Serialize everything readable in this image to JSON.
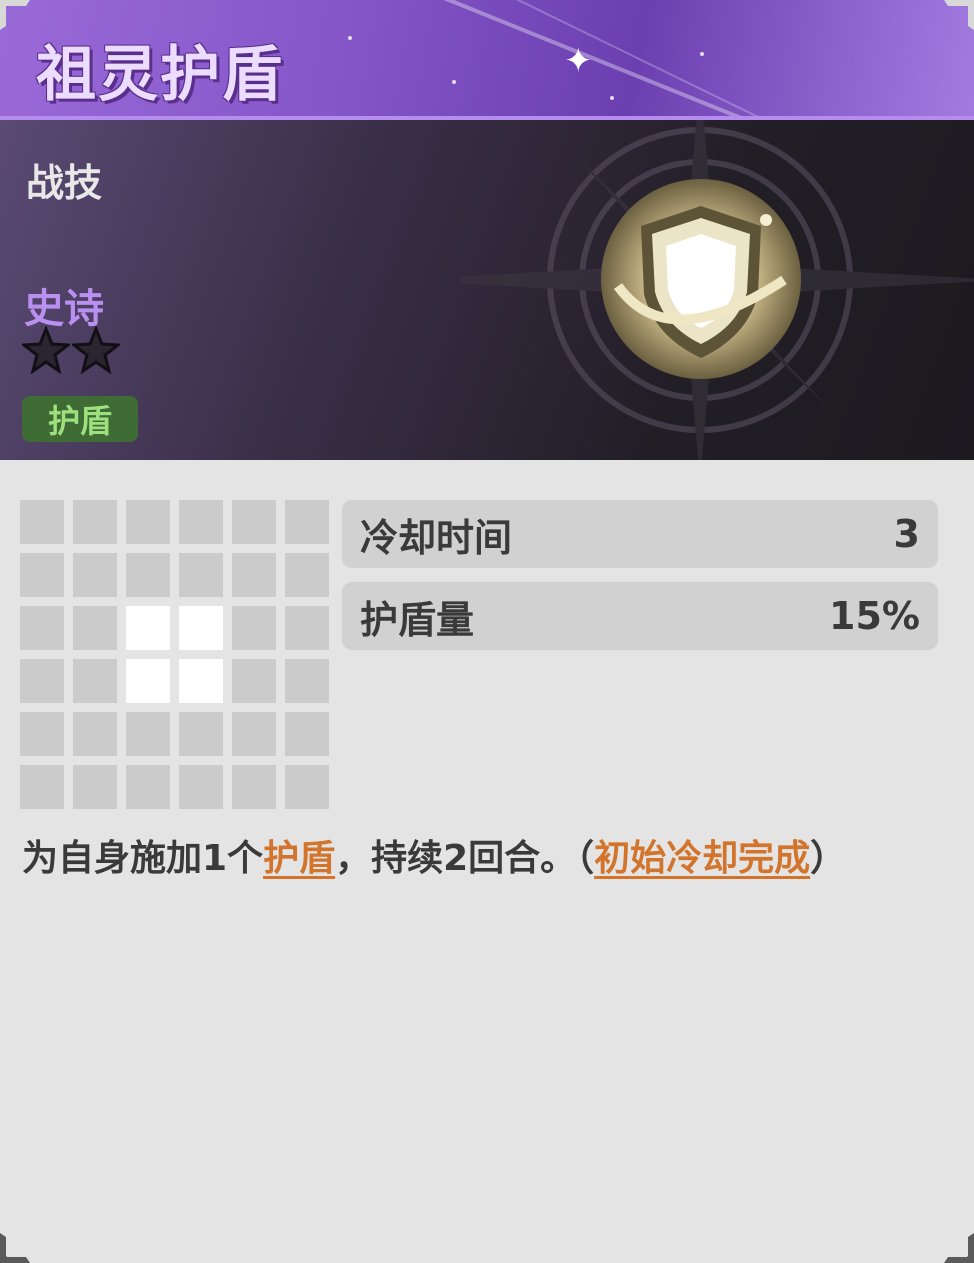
{
  "skill": {
    "name": "祖灵护盾",
    "type": "战技",
    "rarity": "史诗",
    "star_count": 2,
    "tag": "护盾",
    "icon": "shield-icon"
  },
  "range_grid": {
    "rows": 6,
    "cols": 6,
    "active_cells": [
      [
        2,
        2
      ],
      [
        2,
        3
      ],
      [
        3,
        2
      ],
      [
        3,
        3
      ]
    ]
  },
  "stats": [
    {
      "label": "冷却时间",
      "value": "3"
    },
    {
      "label": "护盾量",
      "value": "15%"
    }
  ],
  "description": {
    "part1": "为自身施加1个",
    "keyword1": "护盾",
    "part2": "，持续2回合。（",
    "keyword2": "初始冷却完成",
    "part3": "）"
  },
  "colors": {
    "title_purple": "#8456c8",
    "rarity_purple": "#b98ff0",
    "tag_green": "#3f6b34",
    "keyword_orange": "#d2742b",
    "panel_grey": "#e4e4e4"
  }
}
